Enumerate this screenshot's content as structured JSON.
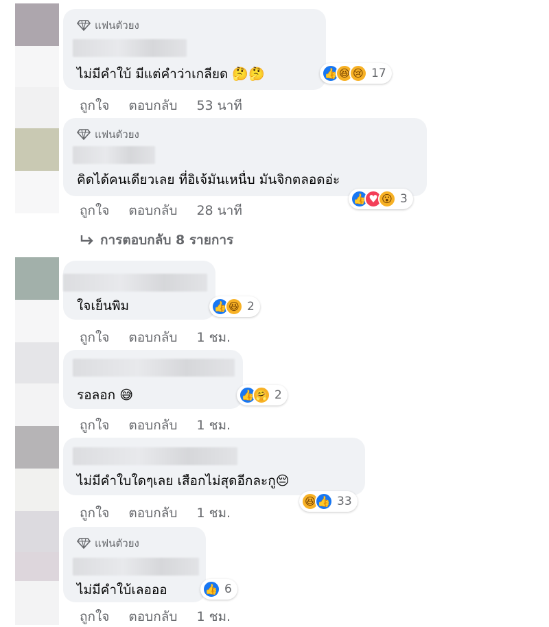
{
  "badge_label": "แฟนตัวยง",
  "actions": {
    "like": "ถูกใจ",
    "reply": "ตอบกลับ"
  },
  "replies_link": "การตอบกลับ 8 รายการ",
  "colors": {
    "bubble": "#f0f2f5",
    "like_blue": "#1877f2",
    "love_red": "#f33e58",
    "haha_yellow": "#f7b125",
    "meta_gray": "#65676b"
  },
  "comments": [
    {
      "text": "ไม่มีคำใบ้ มีแต่คำว่าเกลียด 🤔🤔",
      "time": "53 นาที",
      "reactions": [
        "like",
        "haha",
        "sad"
      ],
      "count": "17"
    },
    {
      "text": "คิดได้คนเดียวเลย ที่อิเจ้มันเหนื่บ มันจิกตลอดอ่ะ",
      "time": "28 นาที",
      "reactions": [
        "like",
        "love",
        "wow"
      ],
      "count": "3"
    },
    {
      "text": "ใจเย็นพิม",
      "time": "1 ชม.",
      "reactions": [
        "like",
        "haha"
      ],
      "count": "2"
    },
    {
      "text": "รอลอก 😅",
      "time": "1 ชม.",
      "reactions": [
        "like",
        "care"
      ],
      "count": "2"
    },
    {
      "text": "ไม่มีคำใบใดๆเลย เสือกไม่สุดอีกละกู😔",
      "time": "1 ชม.",
      "reactions": [
        "haha",
        "like"
      ],
      "count": "33"
    },
    {
      "text": "ไม่มีคำใบ้เลอออ",
      "time": "1 ชม.",
      "reactions": [
        "like"
      ],
      "count": "6"
    }
  ]
}
